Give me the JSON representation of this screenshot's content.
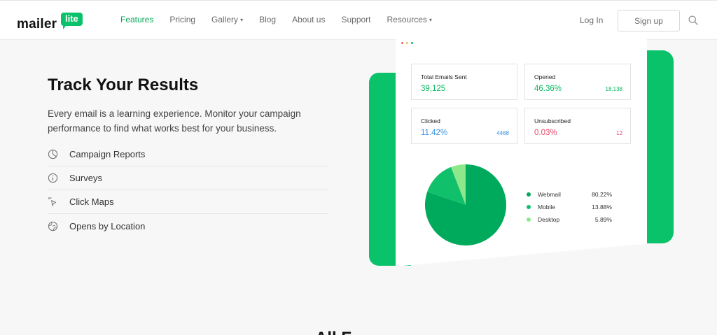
{
  "header": {
    "logo_text": "mailer",
    "logo_badge": "lite",
    "nav": [
      {
        "label": "Features",
        "active": true,
        "dropdown": false
      },
      {
        "label": "Pricing",
        "active": false,
        "dropdown": false
      },
      {
        "label": "Gallery",
        "active": false,
        "dropdown": true
      },
      {
        "label": "Blog",
        "active": false,
        "dropdown": false
      },
      {
        "label": "About us",
        "active": false,
        "dropdown": false
      },
      {
        "label": "Support",
        "active": false,
        "dropdown": false
      },
      {
        "label": "Resources",
        "active": false,
        "dropdown": true
      }
    ],
    "login_label": "Log In",
    "signup_label": "Sign up",
    "search_icon": "search-icon"
  },
  "main": {
    "heading": "Track Your Results",
    "description": "Every email is a learning experience. Monitor your campaign performance to find what works best for your business.",
    "features": [
      {
        "label": "Campaign Reports",
        "icon": "pie-chart-icon"
      },
      {
        "label": "Surveys",
        "icon": "info-icon"
      },
      {
        "label": "Click Maps",
        "icon": "cursor-click-icon"
      },
      {
        "label": "Opens by Location",
        "icon": "globe-icon"
      }
    ]
  },
  "dashboard": {
    "stats": [
      {
        "label": "Total Emails Sent",
        "value": "39,125",
        "count": "",
        "color": "#09b75f"
      },
      {
        "label": "Opened",
        "value": "46.36%",
        "count": "18,138",
        "color": "#09b75f"
      },
      {
        "label": "Clicked",
        "value": "11.42%",
        "count": "4468",
        "color": "#3a8fe0"
      },
      {
        "label": "Unsubscribed",
        "value": "0.03%",
        "count": "12",
        "color": "#e8456b"
      }
    ],
    "legend": [
      {
        "name": "Webmail",
        "pct": "80.22%",
        "color": "#00aa5c"
      },
      {
        "name": "Mobile",
        "pct": "13.88%",
        "color": "#11c06a"
      },
      {
        "name": "Desktop",
        "pct": "5.89%",
        "color": "#8ee88b"
      }
    ],
    "window_dots": [
      "#f56565",
      "#f6c343",
      "#09c269"
    ]
  },
  "colors": {
    "brand_green": "#09c269",
    "nav_active": "#09a85a"
  },
  "bottom": {
    "heading_fragment": "All F"
  }
}
